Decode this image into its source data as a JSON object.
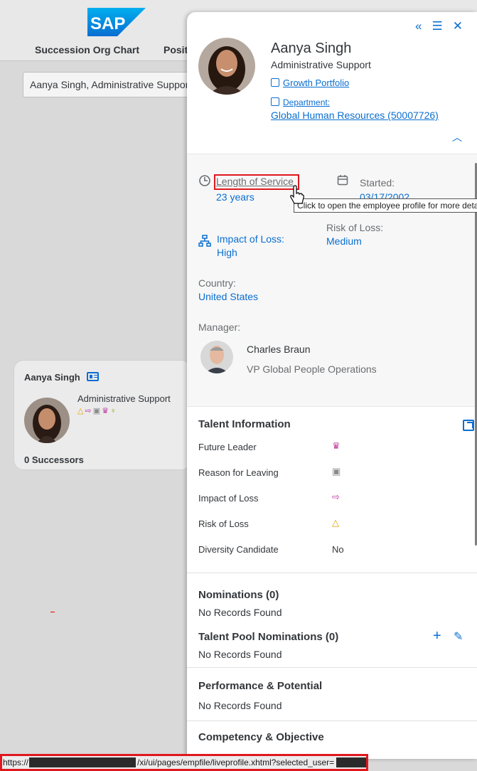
{
  "background": {
    "logo_text": "SAP",
    "nav": [
      "Succession Org Chart",
      "Posit"
    ],
    "search_value": "Aanya Singh, Administrative Support",
    "node": {
      "name": "Aanya Singh",
      "role": "Administrative Support",
      "successors": "0 Successors",
      "icons": [
        "warning-icon",
        "exit-icon",
        "reason-icon",
        "trophy-icon",
        "female-icon"
      ]
    }
  },
  "panel": {
    "actions": [
      "collapse-left-icon",
      "list-icon",
      "close-icon"
    ],
    "name": "Aanya Singh",
    "role": "Administrative Support",
    "growth_portfolio": "Growth Portfolio",
    "department_label": "Department:",
    "department_value": "Global Human Resources (50007726)",
    "length_of_service_label": "Length of Service",
    "length_of_service_value": "23 years",
    "started_label": "Started:",
    "started_value": "03/17/2002",
    "tooltip": "Click to open the employee profile for more details",
    "impact_of_loss_label": "Impact of Loss:",
    "impact_of_loss_value": "High",
    "risk_of_loss_label": "Risk of Loss:",
    "risk_of_loss_value": "Medium",
    "country_label": "Country:",
    "country_value": "United States",
    "manager_label": "Manager:",
    "manager_name": "Charles Braun",
    "manager_title": "VP Global People Operations",
    "talent_title": "Talent Information",
    "talent_rows": [
      {
        "label": "Future Leader",
        "icon": "trophy-icon",
        "color": "#c0399f"
      },
      {
        "label": "Reason for Leaving",
        "icon": "reason-icon",
        "color": "#8a8a8a"
      },
      {
        "label": "Impact of Loss",
        "icon": "exit-icon",
        "color": "#c0399f"
      },
      {
        "label": "Risk of Loss",
        "icon": "warning-icon",
        "color": "#e9a100"
      },
      {
        "label": "Diversity Candidate",
        "value": "No"
      }
    ],
    "nominations_title": "Nominations (0)",
    "nominations_empty": "No Records Found",
    "talent_pool_title": "Talent Pool Nominations (0)",
    "talent_pool_empty": "No Records Found",
    "performance_title": "Performance & Potential",
    "performance_empty": "No Records Found",
    "competency_title": "Competency & Objective"
  },
  "statusbar": {
    "prefix": "https://",
    "path": "/xi/ui/pages/empfile/liveprofile.xhtml?selected_user="
  },
  "colors": {
    "link": "#0a6ed1",
    "highlight": "#e0171f",
    "sap_blue": "#0a6ed1"
  }
}
